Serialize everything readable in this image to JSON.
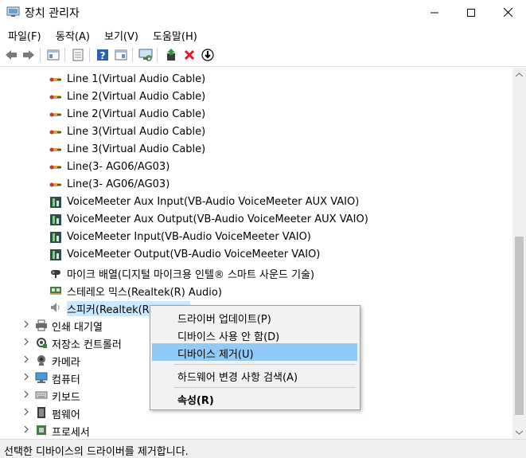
{
  "window": {
    "title": "장치 관리자"
  },
  "menu": [
    "파일(F)",
    "동작(A)",
    "보기(V)",
    "도움말(H)"
  ],
  "toolbar": {
    "icons": [
      "back-arrow-icon",
      "forward-arrow-icon",
      "show-hide-tree-icon",
      "properties-icon",
      "help-icon",
      "action-pane-icon",
      "scan-hardware-icon",
      "update-driver-icon",
      "uninstall-icon",
      "disable-icon"
    ]
  },
  "devices": [
    "Line 1(Virtual Audio Cable)",
    "Line 2(Virtual Audio Cable)",
    "Line 2(Virtual Audio Cable)",
    "Line 3(Virtual Audio Cable)",
    "Line 3(Virtual Audio Cable)",
    "Line(3- AG06/AG03)",
    "Line(3- AG06/AG03)",
    "VoiceMeeter Aux Input(VB-Audio VoiceMeeter AUX VAIO)",
    "VoiceMeeter Aux Output(VB-Audio VoiceMeeter AUX VAIO)",
    "VoiceMeeter Input(VB-Audio VoiceMeeter VAIO)",
    "VoiceMeeter Output(VB-Audio VoiceMeeter VAIO)",
    "마이크 배열(디지털 마이크용 인텔® 스마트 사운드 기술)",
    "스테레오 믹스(Realtek(R) Audio)",
    "스피커(Realtek(R) Audio)"
  ],
  "categories": [
    "인쇄 대기열",
    "저장소 컨트롤러",
    "카메라",
    "컴퓨터",
    "키보드",
    "펌웨어",
    "프로세서"
  ],
  "context_menu": {
    "update_driver": "드라이버 업데이트(P)",
    "disable_device": "디바이스 사용 안 함(D)",
    "uninstall_device": "디바이스 제거(U)",
    "scan_hardware": "하드웨어 변경 사항 검색(A)",
    "properties": "속성(R)"
  },
  "status": {
    "text": "선택한 디바이스의 드라이버를 제거합니다."
  },
  "colors": {
    "selection": "#cce8ff",
    "menu_highlight": "#91c9f7",
    "uninstall_red": "#e81123"
  }
}
